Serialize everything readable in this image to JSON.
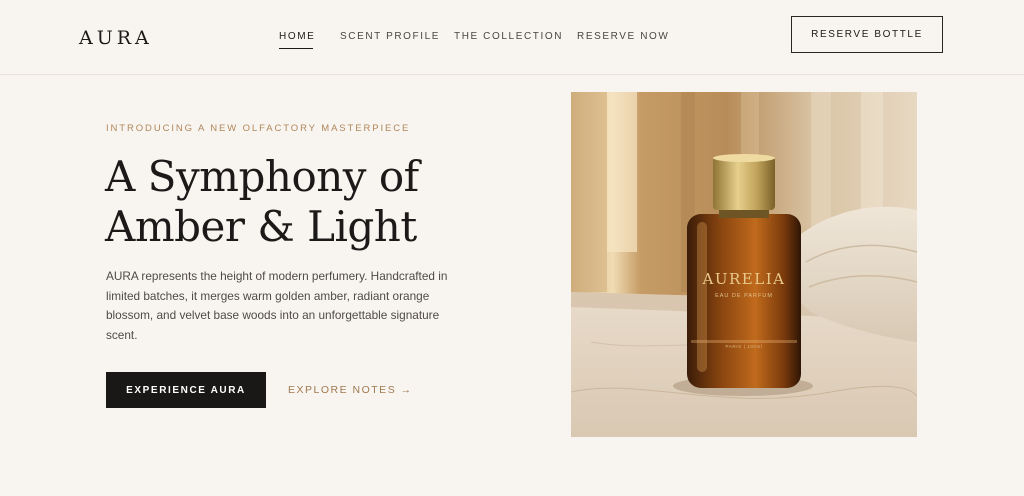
{
  "header": {
    "logo": "AURA",
    "nav": [
      {
        "label": "HOME",
        "active": true
      },
      {
        "label": "SCENT PROFILE",
        "active": false
      },
      {
        "label": "THE COLLECTION",
        "active": false
      },
      {
        "label": "RESERVE NOW",
        "active": false
      }
    ],
    "reserve_button": "RESERVE BOTTLE"
  },
  "hero": {
    "eyebrow": "INTRODUCING A NEW OLFACTORY MASTERPIECE",
    "headline_line1": "A Symphony of",
    "headline_line2": "Amber & Light",
    "body": "AURA represents the height of modern perfumery. Handcrafted in limited batches, it merges warm golden amber, radiant orange blossom, and velvet base woods into an unforgettable signature scent.",
    "primary_cta": "EXPERIENCE AURA",
    "secondary_cta": "EXPLORE NOTES →"
  },
  "product_image": {
    "brand": "AURELIA",
    "subtitle": "EAU DE PARFUM",
    "footer": "PARIS | 100ml"
  },
  "colors": {
    "background": "#f8f5f1",
    "accent": "#b0865a",
    "dark": "#1a1816"
  }
}
